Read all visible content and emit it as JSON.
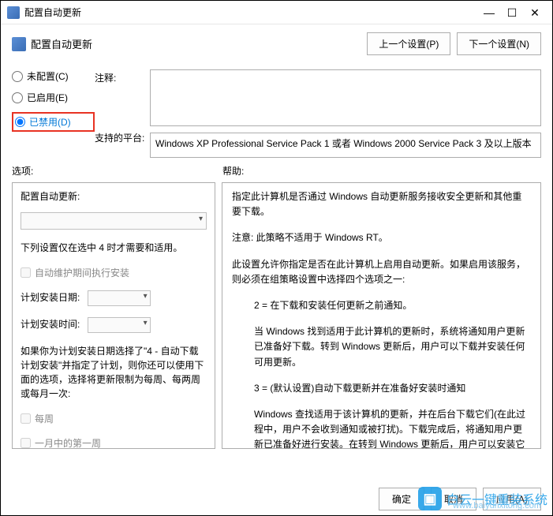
{
  "window": {
    "title": "配置自动更新",
    "minimize": "—",
    "maximize": "☐",
    "close": "✕"
  },
  "header": {
    "title": "配置自动更新",
    "prev": "上一个设置(P)",
    "next": "下一个设置(N)"
  },
  "radios": {
    "notconfigured": "未配置(C)",
    "enabled": "已启用(E)",
    "disabled": "已禁用(D)",
    "selected": "disabled"
  },
  "labels": {
    "comment": "注释:",
    "platform": "支持的平台:",
    "options": "选项:",
    "help": "帮助:"
  },
  "platform_text": "Windows XP Professional Service Pack 1 或者 Windows 2000 Service Pack 3 及以上版本",
  "options": {
    "heading": "配置自动更新:",
    "note": "下列设置仅在选中 4 时才需要和适用。",
    "chk_maint": "自动维护期间执行安装",
    "sched_day": "计划安装日期:",
    "sched_time": "计划安装时间:",
    "para": "如果你为计划安装日期选择了\"4 - 自动下载计划安装\"并指定了计划，则你还可以使用下面的选项，选择将更新限制为每周、每两周或每月一次:",
    "chk_weekly": "每周",
    "chk_first_week": "一月中的第一周"
  },
  "help": {
    "p1": "指定此计算机是否通过 Windows 自动更新服务接收安全更新和其他重要下载。",
    "p2": "注意: 此策略不适用于 Windows RT。",
    "p3": "此设置允许你指定是否在此计算机上启用自动更新。如果启用该服务，则必须在组策略设置中选择四个选项之一:",
    "p4": "2 = 在下载和安装任何更新之前通知。",
    "p5": "当 Windows 找到适用于此计算机的更新时，系统将通知用户更新已准备好下载。转到 Windows 更新后，用户可以下载并安装任何可用更新。",
    "p6": "3 = (默认设置)自动下载更新并在准备好安装时通知",
    "p7": "Windows 查找适用于该计算机的更新，并在后台下载它们(在此过程中，用户不会收到通知或被打扰)。下载完成后，将通知用户更新已准备好进行安装。在转到 Windows 更新后，用户可以安装它们。"
  },
  "footer": {
    "ok": "确定",
    "cancel": "取消",
    "apply": "应用(A)"
  },
  "watermark": {
    "brand": "白云一键重装系统",
    "url": "www.baiyunxitong.com"
  }
}
